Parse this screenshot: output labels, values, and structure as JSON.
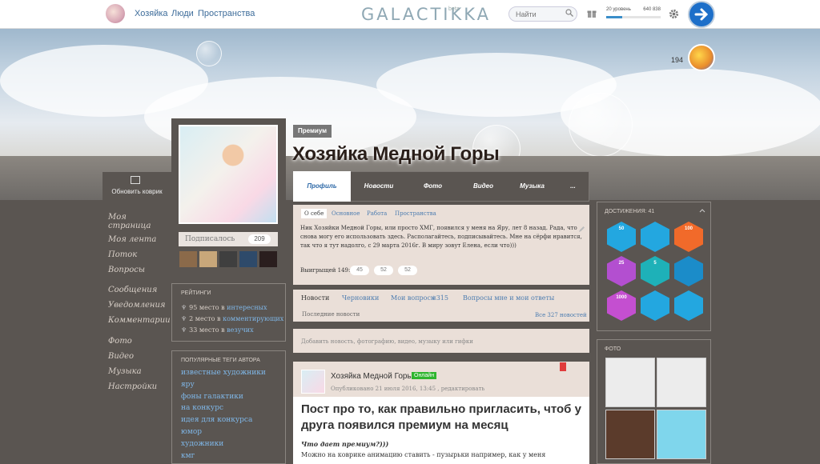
{
  "header": {
    "username": "Хозяйка",
    "nav_people": "Люди",
    "nav_spaces": "Пространства",
    "logo": "GALACTIKKA",
    "beta": "beta",
    "search_placeholder": "Найти",
    "level_label": "20 уровень",
    "level_points": "640 838",
    "level_progress": 0.3
  },
  "cover": {
    "update_label": "Обновить коврик",
    "counter": "194"
  },
  "sidebar": {
    "items": [
      "Моя страница",
      "Моя лента",
      "Поток",
      "Вопросы",
      "Сообщения",
      "Уведомления",
      "Комментарии",
      "Фото",
      "Видео",
      "Музыка",
      "Настройки"
    ]
  },
  "profile": {
    "premium": "Премиум",
    "name": "Хозяйка Медной Горы",
    "subscribed_label": "Подписалось",
    "subscribed_count": "209"
  },
  "ratings": {
    "title": "рейтинги",
    "lines": [
      {
        "prefix": "95 место в ",
        "link": "интересных"
      },
      {
        "prefix": "2 место в ",
        "link": "комментирующих"
      },
      {
        "prefix": "33 место в ",
        "link": "везучих"
      }
    ]
  },
  "tags": {
    "title": "популярные теги автора",
    "items": [
      "известные художники",
      "яру",
      "фоны галактики",
      "на конкурс",
      "идея для конкурса",
      "юмор",
      "художники",
      "кмг"
    ]
  },
  "tabs": [
    "Профиль",
    "Новости",
    "Фото",
    "Видео",
    "Музыка",
    "..."
  ],
  "about": {
    "subtabs": [
      "О себе",
      "Основное",
      "Работа",
      "Пространства"
    ],
    "text": "Ник Хозяйки Медной Горы, или просто ХМГ, появился у меня на Яру, лет 8 назад. Рада, что снова могу его использовать здесь. Располагайтесь, подписывайтесь. Мне на сёрфи нравится, так что я тут надолго, с 29 марта 2016г. В миру зовут Елена, если что)))",
    "won_label": "Выигрыщей 149:",
    "won": [
      "45",
      "52",
      "52"
    ]
  },
  "news": {
    "tabs": [
      "Новости",
      "Черновики",
      "Мои вопросы",
      "+315",
      "Вопросы мне и мои ответы"
    ],
    "last_label": "Последние новости",
    "all_label": "Все 327 новостей",
    "add_label": "Добавить новость, фотографию, видео, музыку или гифки"
  },
  "post": {
    "author": "Хозяйка Медной Горы",
    "online": "Онлайн",
    "date": "Опубликовано 21 июля 2016, 13:45 , редактировать",
    "title": "Пост про то, как правильно пригласить, чтоб у друга появился премиум на месяц",
    "subtitle": "Что дает премиум?)))",
    "body": "Можно на коврике анимацию ставить - пузырьки например, как у меня"
  },
  "achievements": {
    "title": "достижения: 41",
    "badges": [
      {
        "label": "50",
        "color": "#23a7e0"
      },
      {
        "label": "",
        "color": "#23a7e0"
      },
      {
        "label": "100",
        "color": "#f16a2a"
      },
      {
        "label": "25",
        "color": "#b34fd0"
      },
      {
        "label": "5",
        "color": "#1eb1b8"
      },
      {
        "label": "",
        "color": "#1b8cc9"
      },
      {
        "label": "1000",
        "color": "#c44fd0"
      },
      {
        "label": "",
        "color": "#23a7e0"
      },
      {
        "label": "",
        "color": "#23a7e0"
      }
    ]
  },
  "photos": {
    "title": "фото"
  }
}
